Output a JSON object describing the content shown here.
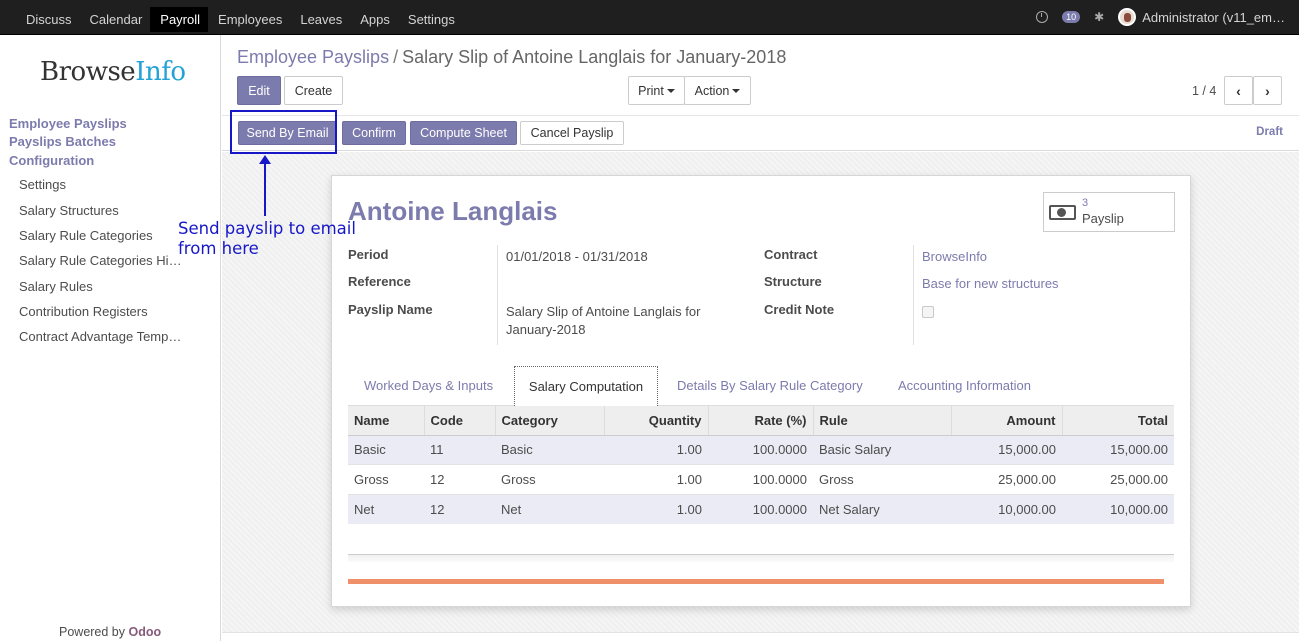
{
  "topbar": {
    "menu": [
      "Discuss",
      "Calendar",
      "Payroll",
      "Employees",
      "Leaves",
      "Apps",
      "Settings"
    ],
    "active_menu": "Payroll",
    "message_count": "10",
    "user": "Administrator (v11_em…"
  },
  "sidebar": {
    "logo_browse": "Browse",
    "logo_info": "Info",
    "headers": [
      "Employee Payslips",
      "Payslips Batches",
      "Configuration"
    ],
    "items": [
      "Settings",
      "Salary Structures",
      "Salary Rule Categories",
      "Salary Rule Categories Hi…",
      "Salary Rules",
      "Contribution Registers",
      "Contract Advantage Temp…"
    ],
    "powered_by": "Powered by",
    "powered_brand": "Odoo"
  },
  "breadcrumb": {
    "parent": "Employee Payslips",
    "separator": "/",
    "current": "Salary Slip of Antoine Langlais for January-2018"
  },
  "toolbar": {
    "edit": "Edit",
    "create": "Create",
    "print": "Print",
    "action": "Action",
    "pager": "1 / 4"
  },
  "statusbar": {
    "send_email": "Send By Email",
    "confirm": "Confirm",
    "compute": "Compute Sheet",
    "cancel": "Cancel Payslip",
    "state": "Draft"
  },
  "annotation": {
    "text": "Send payslip to email\nfrom here"
  },
  "form": {
    "employee": "Antoine Langlais",
    "stat_count": "3",
    "stat_label": "Payslip",
    "labels": {
      "period": "Period",
      "reference": "Reference",
      "payslip_name": "Payslip Name",
      "contract": "Contract",
      "structure": "Structure",
      "credit_note": "Credit Note"
    },
    "values": {
      "period": "01/01/2018 - 01/31/2018",
      "payslip_name_1": "Salary Slip of Antoine Langlais for",
      "payslip_name_2": "January-2018",
      "contract": "BrowseInfo",
      "structure": "Base for new structures"
    }
  },
  "tabs": [
    "Worked Days & Inputs",
    "Salary Computation",
    "Details By Salary Rule Category",
    "Accounting Information"
  ],
  "table": {
    "headers": [
      "Name",
      "Code",
      "Category",
      "Quantity",
      "Rate (%)",
      "Rule",
      "Amount",
      "Total"
    ],
    "rows": [
      [
        "Basic",
        "11",
        "Basic",
        "1.00",
        "100.0000",
        "Basic Salary",
        "15,000.00",
        "15,000.00"
      ],
      [
        "Gross",
        "12",
        "Gross",
        "1.00",
        "100.0000",
        "Gross",
        "25,000.00",
        "25,000.00"
      ],
      [
        "Net",
        "12",
        "Net",
        "1.00",
        "100.0000",
        "Net Salary",
        "10,000.00",
        "10,000.00"
      ]
    ]
  },
  "colors": {
    "accent": "#7c7bad",
    "annotation": "#1717c8",
    "topbar": "#1f1f1f"
  }
}
